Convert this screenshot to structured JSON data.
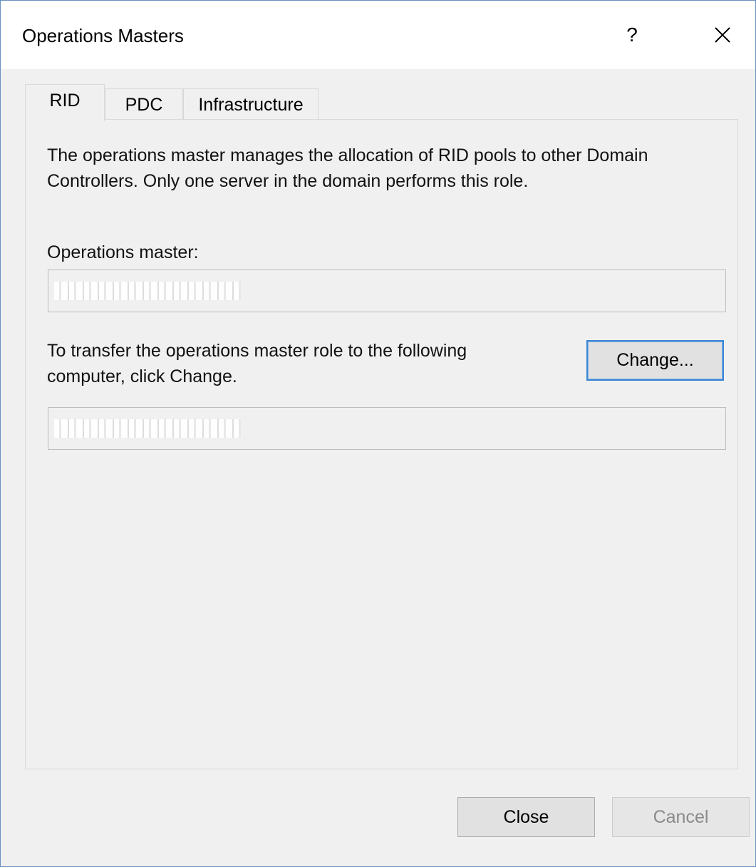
{
  "window": {
    "title": "Operations Masters",
    "help_label": "?",
    "close_icon": "close-icon"
  },
  "tabs": [
    {
      "label": "RID",
      "active": true
    },
    {
      "label": "PDC",
      "active": false
    },
    {
      "label": "Infrastructure",
      "active": false
    }
  ],
  "rid_panel": {
    "description": "The operations master manages the allocation of RID pools to other Domain Controllers. Only one server in the domain performs this role.",
    "operations_master_label": "Operations master:",
    "operations_master_value": "",
    "transfer_text": "To transfer the operations master role to the following computer, click Change.",
    "target_computer_value": "",
    "change_button": "Change..."
  },
  "footer": {
    "close_button": "Close",
    "cancel_button": "Cancel",
    "cancel_enabled": false
  },
  "colors": {
    "window_border": "#6a8fc0",
    "focus_border": "#3c85d4",
    "background": "#f0f0f0"
  }
}
